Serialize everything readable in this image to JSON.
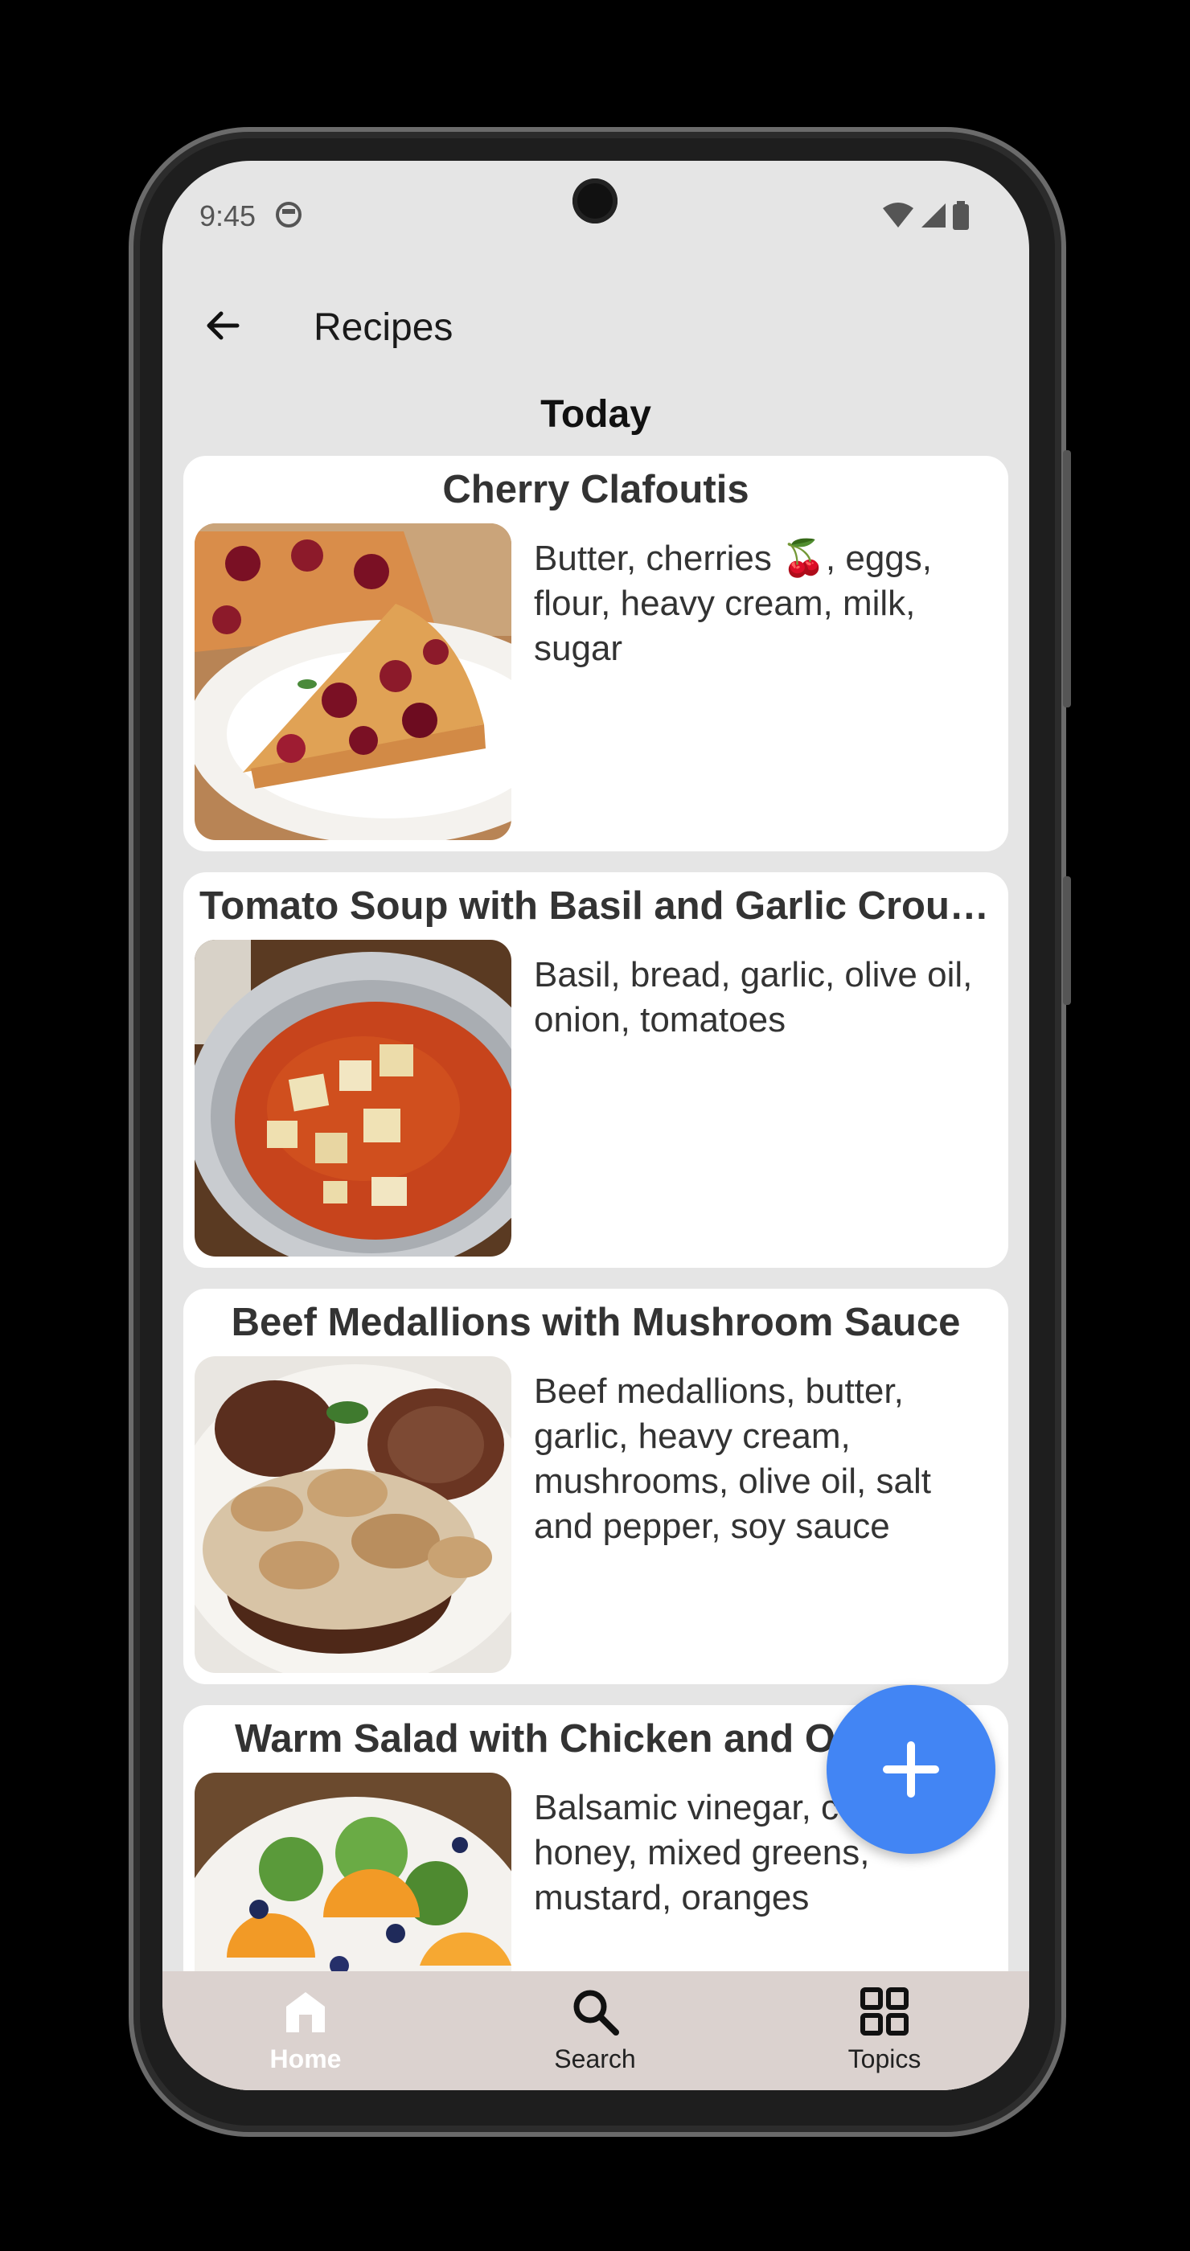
{
  "status": {
    "time": "9:45"
  },
  "appbar": {
    "title": "Recipes"
  },
  "section_title": "Today",
  "recipes": [
    {
      "title": "Cherry Clafoutis",
      "ingredients": "Butter, cherries 🍒, eggs, flour, heavy cream, milk, sugar"
    },
    {
      "title": "Tomato Soup with Basil and Garlic Crout...",
      "ingredients": "Basil, bread, garlic, olive oil, onion, tomatoes"
    },
    {
      "title": "Beef Medallions with Mushroom Sauce",
      "ingredients": "Beef medallions, butter, garlic, heavy cream, mushrooms, olive oil, salt and pepper, soy sauce"
    },
    {
      "title": "Warm Salad with Chicken and Or",
      "ingredients": "Balsamic vinegar, c breast, honey, mixed greens, mustard, oranges"
    }
  ],
  "nav": [
    {
      "label": "Home",
      "icon": "home-icon",
      "active": true
    },
    {
      "label": "Search",
      "icon": "search-icon",
      "active": false
    },
    {
      "label": "Topics",
      "icon": "grid-icon",
      "active": false
    }
  ],
  "colors": {
    "fab": "#4285f4",
    "navbar": "#dbd2cf",
    "screen_bg": "#e5e5e5"
  }
}
